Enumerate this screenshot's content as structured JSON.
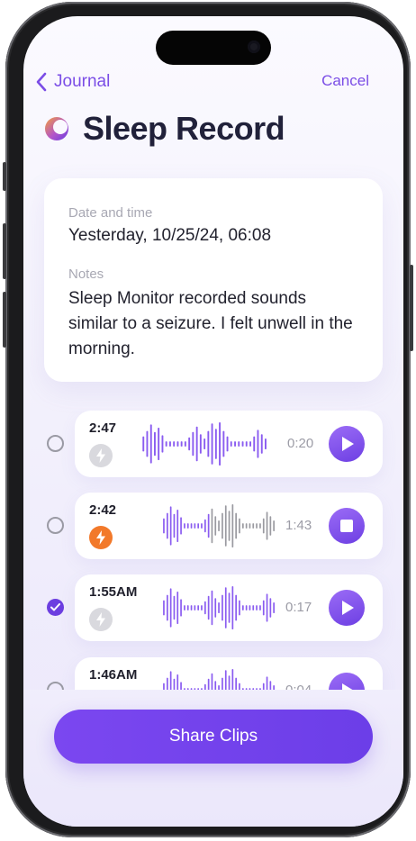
{
  "nav": {
    "back_label": "Journal",
    "cancel_label": "Cancel"
  },
  "header": {
    "title": "Sleep Record",
    "icon": "moon-icon"
  },
  "details": {
    "date_label": "Date and time",
    "date_value": "Yesterday, 10/25/24, 06:08",
    "notes_label": "Notes",
    "notes_value": "Sleep Monitor recorded sounds similar to a seizure. I felt unwell in the morning."
  },
  "clips": [
    {
      "time": "2:47",
      "duration": "0:20",
      "selected": false,
      "event_active": false,
      "state": "play"
    },
    {
      "time": "2:42",
      "duration": "1:43",
      "selected": false,
      "event_active": true,
      "state": "stop"
    },
    {
      "time": "1:55AM",
      "duration": "0:17",
      "selected": true,
      "event_active": false,
      "state": "play"
    },
    {
      "time": "1:46AM",
      "duration": "0:04",
      "selected": false,
      "event_active": false,
      "state": "play"
    }
  ],
  "actions": {
    "share_label": "Share Clips"
  },
  "colors": {
    "accent": "#7b4de6",
    "title": "#21213a",
    "event_active": "#f2792a",
    "event_inactive": "#d9d9de",
    "wave_played": "#8a5cf0",
    "wave_unplayed": "#9a9aa0"
  }
}
